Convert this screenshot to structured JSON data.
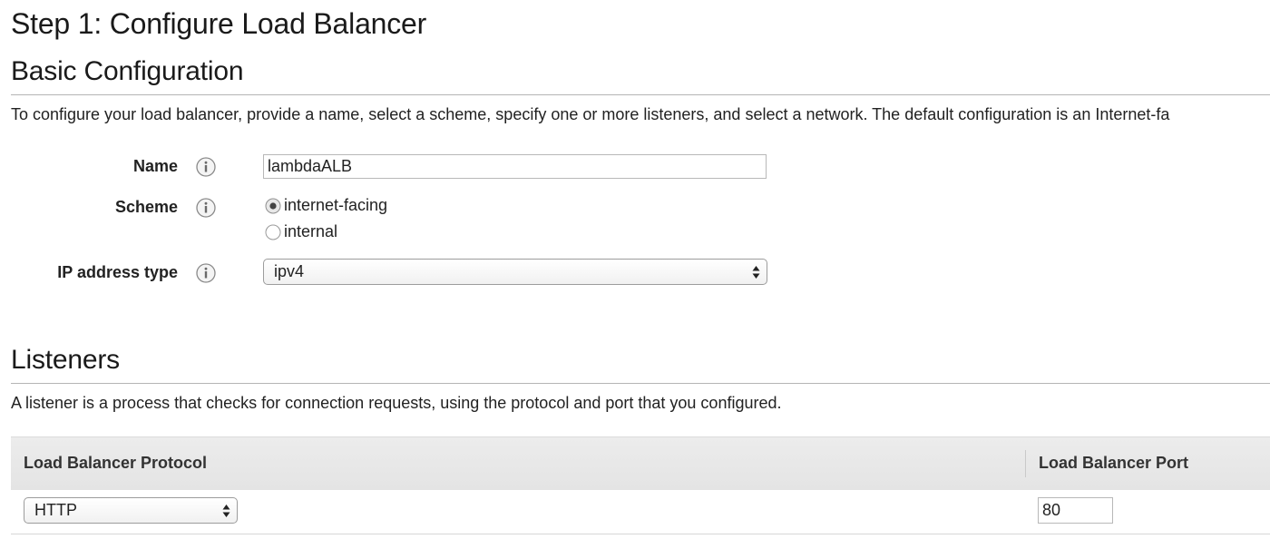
{
  "page": {
    "step_title": "Step 1: Configure Load Balancer"
  },
  "basic": {
    "heading": "Basic Configuration",
    "description": "To configure your load balancer, provide a name, select a scheme, specify one or more listeners, and select a network. The default configuration is an Internet-fa",
    "name_label": "Name",
    "name_value": "lambdaALB",
    "scheme_label": "Scheme",
    "scheme_options": [
      {
        "label": "internet-facing",
        "selected": true
      },
      {
        "label": "internal",
        "selected": false
      }
    ],
    "ip_label": "IP address type",
    "ip_value": "ipv4"
  },
  "listeners": {
    "heading": "Listeners",
    "description": "A listener is a process that checks for connection requests, using the protocol and port that you configured.",
    "columns": [
      "Load Balancer Protocol",
      "Load Balancer Port"
    ],
    "rows": [
      {
        "protocol": "HTTP",
        "port": "80"
      }
    ]
  },
  "icons": {
    "info": "info-icon",
    "radio_selected": "radio-selected-icon",
    "radio_unselected": "radio-unselected-icon",
    "select_arrows": "select-arrows-icon"
  },
  "colors": {
    "text": "#222222",
    "rule": "#b5b5b5",
    "header_bg": "#e8e8e8",
    "input_border": "#b8b8b8"
  }
}
